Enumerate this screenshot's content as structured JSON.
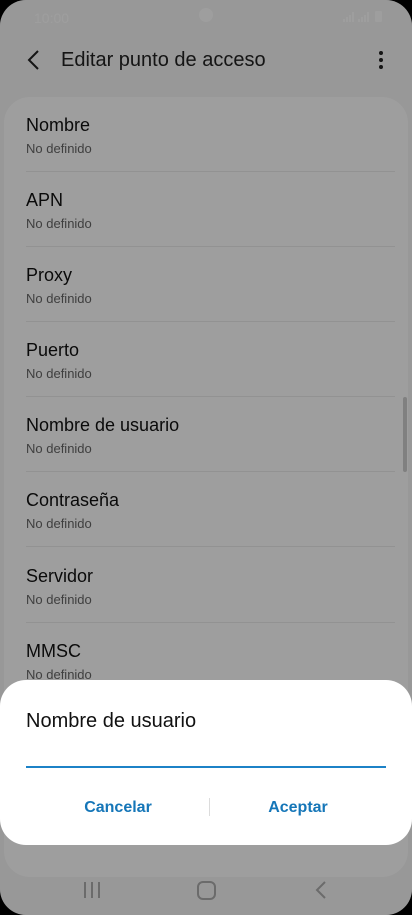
{
  "status_bar": {
    "time": "10:00"
  },
  "header": {
    "title": "Editar punto de acceso"
  },
  "list": {
    "items": [
      {
        "title": "Nombre",
        "value": "No definido"
      },
      {
        "title": "APN",
        "value": "No definido"
      },
      {
        "title": "Proxy",
        "value": "No definido"
      },
      {
        "title": "Puerto",
        "value": "No definido"
      },
      {
        "title": "Nombre de usuario",
        "value": "No definido"
      },
      {
        "title": "Contraseña",
        "value": "No definido"
      },
      {
        "title": "Servidor",
        "value": "No definido"
      },
      {
        "title": "MMSC",
        "value": "No definido"
      }
    ]
  },
  "dialog": {
    "title": "Nombre de usuario",
    "input_value": "",
    "cancel_label": "Cancelar",
    "accept_label": "Aceptar"
  },
  "colors": {
    "accent": "#1576b8",
    "input_underline": "#1c82c7"
  },
  "icons": {
    "header_back": "chevron-left-icon",
    "header_more": "more-vertical-icon",
    "nav_recents": "recents-icon",
    "nav_home": "home-icon",
    "nav_back": "back-icon"
  }
}
